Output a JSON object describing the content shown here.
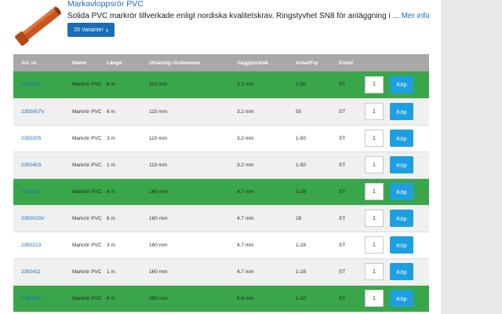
{
  "product": {
    "title": "Markavloppsrör PVC",
    "description": "Solida PVC markrör tillverkade enligt nordiska kvalitetskrav. Ringstyvhet SN8 för anläggning i ...",
    "more_link": "Mer info",
    "variants_button": "20 Varianter",
    "image_icon": "orange-pipe-image"
  },
  "table": {
    "headers": [
      "Art. nr.",
      "Namn",
      "Längd",
      "Utvändig rördiameter",
      "Väggtjocklek",
      "Antal/Frp",
      "Enhet",
      ""
    ],
    "buy_label": "Köp",
    "rows": [
      {
        "art": "2350007",
        "name": "Markrör PVC",
        "len": "6 m",
        "dia": "110 mm",
        "wall": "3.2 mm",
        "qty_pkg": "1-50",
        "unit": "ST",
        "qty": "1",
        "hl": true
      },
      {
        "art": "2350007V",
        "name": "Markrör PVC",
        "len": "6 m",
        "dia": "110 mm",
        "wall": "3.2 mm",
        "qty_pkg": "50",
        "unit": "ST",
        "qty": "1",
        "hl": false
      },
      {
        "art": "2350205",
        "name": "Markrör PVC",
        "len": "3 m",
        "dia": "110 mm",
        "wall": "3.2 mm",
        "qty_pkg": "1-50",
        "unit": "ST",
        "qty": "1",
        "hl": false
      },
      {
        "art": "2350403",
        "name": "Markrör PVC",
        "len": "1 m",
        "dia": "110 mm",
        "wall": "3.2 mm",
        "qty_pkg": "1-50",
        "unit": "ST",
        "qty": "1",
        "hl": false
      },
      {
        "art": "2350015",
        "name": "Markrör PVC",
        "len": "6 m",
        "dia": "160 mm",
        "wall": "4.7 mm",
        "qty_pkg": "1-28",
        "unit": "ST",
        "qty": "1",
        "hl": true
      },
      {
        "art": "2350015V",
        "name": "Markrör PVC",
        "len": "6 m",
        "dia": "160 mm",
        "wall": "4.7 mm",
        "qty_pkg": "28",
        "unit": "ST",
        "qty": "1",
        "hl": false
      },
      {
        "art": "2350213",
        "name": "Markrör PVC",
        "len": "3 m",
        "dia": "160 mm",
        "wall": "4.7 mm",
        "qty_pkg": "1-28",
        "unit": "ST",
        "qty": "1",
        "hl": false
      },
      {
        "art": "2350411",
        "name": "Markrör PVC",
        "len": "1 m",
        "dia": "160 mm",
        "wall": "4.7 mm",
        "qty_pkg": "1-28",
        "unit": "ST",
        "qty": "1",
        "hl": false
      },
      {
        "art": "2350023",
        "name": "Markrör PVC",
        "len": "6 m",
        "dia": "200 mm",
        "wall": "5.9 mm",
        "qty_pkg": "1-20",
        "unit": "ST",
        "qty": "1",
        "hl": true
      }
    ]
  },
  "colors": {
    "highlight_row": "#3aa64a",
    "header_bg": "#a8a8a8",
    "link": "#1a6eb5",
    "buy_button": "#1ea0e0"
  }
}
